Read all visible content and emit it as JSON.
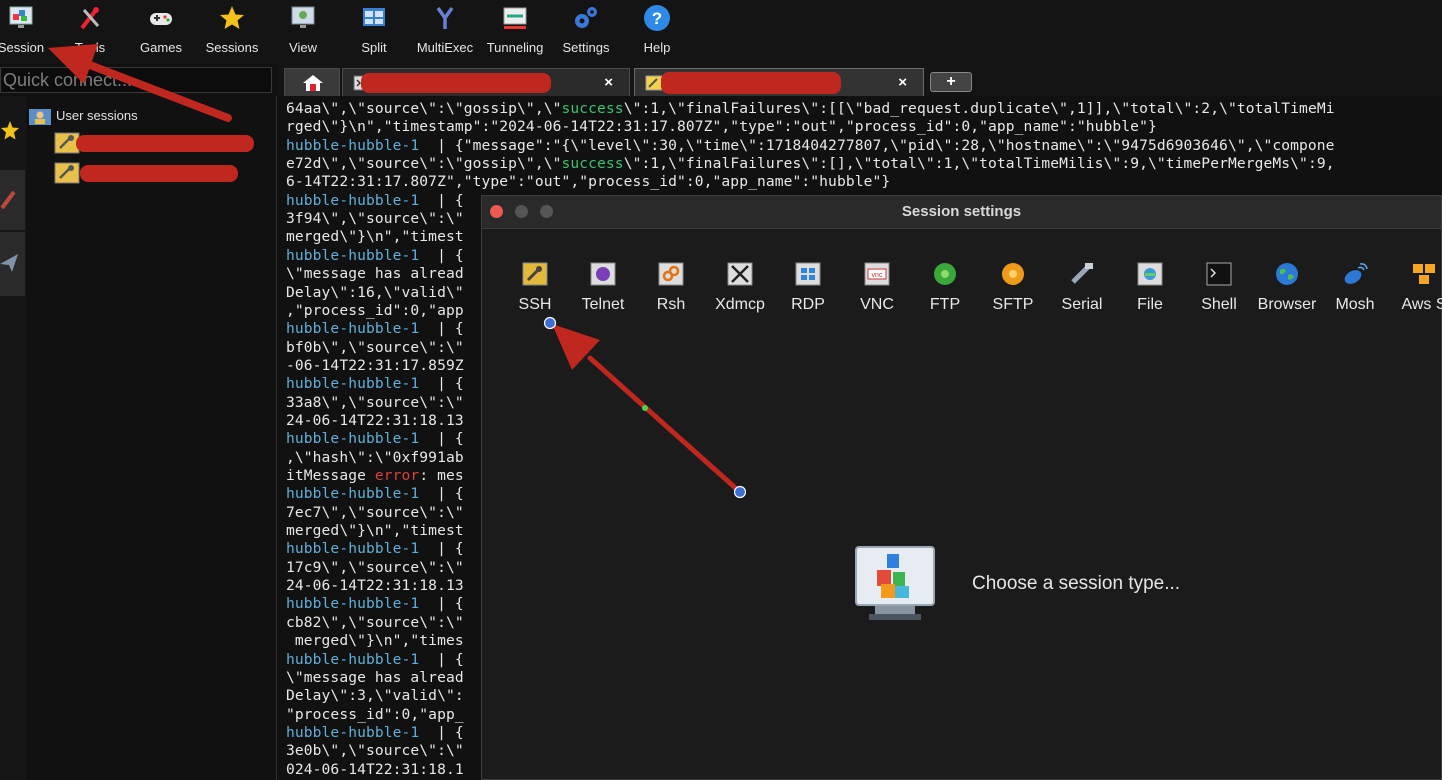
{
  "toolbar": {
    "items": [
      {
        "label": "Session",
        "icon": "session-icon"
      },
      {
        "label": "Tools",
        "icon": "tools-icon"
      },
      {
        "label": "Games",
        "icon": "gamepad-icon"
      },
      {
        "label": "Sessions",
        "icon": "star-icon"
      },
      {
        "label": "View",
        "icon": "view-icon"
      },
      {
        "label": "Split",
        "icon": "split-icon"
      },
      {
        "label": "MultiExec",
        "icon": "multiexec-icon"
      },
      {
        "label": "Tunneling",
        "icon": "tunneling-icon"
      },
      {
        "label": "Settings",
        "icon": "gears-icon"
      },
      {
        "label": "Help",
        "icon": "help-icon"
      }
    ]
  },
  "quick_connect": {
    "placeholder": "Quick connect..."
  },
  "sidebar": {
    "user_sessions_label": "User sessions"
  },
  "tabs": {
    "close_glyph": "×",
    "add_glyph": "+"
  },
  "terminal": {
    "lines": [
      [
        {
          "t": "64aa\\\",\\\"source\\\":\\\"gossip\\\",\\\""
        },
        {
          "t": "success",
          "c": "ok"
        },
        {
          "t": "\\\":1,\\\"finalFailures\\\":[[\\\"bad_request.duplicate\\\",1]],\\\"total\\\":2,\\\"totalTimeMi"
        }
      ],
      [
        {
          "t": "rged\\\"}\\n\",\"timestamp\":\"2024-06-14T22:31:17.807Z\",\"type\":\"out\",\"process_id\":0,\"app_name\":\"hubble\"}"
        }
      ],
      [
        {
          "t": "hubble-hubble-1",
          "c": "host"
        },
        {
          "t": "  | {\"message\":\"{\\\"level\\\":30,\\\"time\\\":1718404277807,\\\"pid\\\":28,\\\"hostname\\\":\\\"9475d6903646\\\",\\\"compone"
        }
      ],
      [
        {
          "t": "e72d\\\",\\\"source\\\":\\\"gossip\\\",\\\""
        },
        {
          "t": "success",
          "c": "ok"
        },
        {
          "t": "\\\":1,\\\"finalFailures\\\":[],\\\"total\\\":1,\\\"totalTimeMilis\\\":9,\\\"timePerMergeMs\\\":9,"
        }
      ],
      [
        {
          "t": "6-14T22:31:17.807Z\",\"type\":\"out\",\"process_id\":0,\"app_name\":\"hubble\"}"
        }
      ],
      [
        {
          "t": "hubble-hubble-1",
          "c": "host"
        },
        {
          "t": "  | {"
        }
      ],
      [
        {
          "t": "3f94\\\",\\\"source\\\":\\\""
        }
      ],
      [
        {
          "t": "merged\\\"}\\n\",\"timest"
        }
      ],
      [
        {
          "t": "hubble-hubble-1",
          "c": "host"
        },
        {
          "t": "  | {"
        }
      ],
      [
        {
          "t": "\\\"message has alread"
        }
      ],
      [
        {
          "t": "Delay\\\":16,\\\"valid\\\""
        }
      ],
      [
        {
          "t": ",\"process_id\":0,\"app"
        }
      ],
      [
        {
          "t": "hubble-hubble-1",
          "c": "host"
        },
        {
          "t": "  | {"
        }
      ],
      [
        {
          "t": "bf0b\\\",\\\"source\\\":\\\""
        }
      ],
      [
        {
          "t": "-06-14T22:31:17.859Z"
        }
      ],
      [
        {
          "t": "hubble-hubble-1",
          "c": "host"
        },
        {
          "t": "  | {"
        }
      ],
      [
        {
          "t": "33a8\\\",\\\"source\\\":\\\""
        }
      ],
      [
        {
          "t": "24-06-14T22:31:18.13"
        }
      ],
      [
        {
          "t": "hubble-hubble-1",
          "c": "host"
        },
        {
          "t": "  | {"
        }
      ],
      [
        {
          "t": ",\\\"hash\\\":\\\"0xf991ab"
        }
      ],
      [
        {
          "t": "itMessage "
        },
        {
          "t": "error",
          "c": "err"
        },
        {
          "t": ": mes"
        }
      ],
      [
        {
          "t": "hubble-hubble-1",
          "c": "host"
        },
        {
          "t": "  | {"
        }
      ],
      [
        {
          "t": "7ec7\\\",\\\"source\\\":\\\""
        }
      ],
      [
        {
          "t": "merged\\\"}\\n\",\"timest"
        }
      ],
      [
        {
          "t": "hubble-hubble-1",
          "c": "host"
        },
        {
          "t": "  | {"
        }
      ],
      [
        {
          "t": "17c9\\\",\\\"source\\\":\\\""
        }
      ],
      [
        {
          "t": "24-06-14T22:31:18.13"
        }
      ],
      [
        {
          "t": "hubble-hubble-1",
          "c": "host"
        },
        {
          "t": "  | {"
        }
      ],
      [
        {
          "t": "cb82\\\",\\\"source\\\":\\\""
        }
      ],
      [
        {
          "t": " merged\\\"}\\n\",\"times"
        }
      ],
      [
        {
          "t": "hubble-hubble-1",
          "c": "host"
        },
        {
          "t": "  | {"
        }
      ],
      [
        {
          "t": "\\\"message has alread"
        }
      ],
      [
        {
          "t": "Delay\\\":3,\\\"valid\\\":"
        }
      ],
      [
        {
          "t": "\"process_id\":0,\"app_"
        }
      ],
      [
        {
          "t": "hubble-hubble-1",
          "c": "host"
        },
        {
          "t": "  | {"
        }
      ],
      [
        {
          "t": "3e0b\\\",\\\"source\\\":\\\""
        }
      ],
      [
        {
          "t": "024-06-14T22:31:18.1"
        }
      ]
    ]
  },
  "dialog": {
    "title": "Session settings",
    "session_types": [
      {
        "label": "SSH",
        "icon": "ssh-icon"
      },
      {
        "label": "Telnet",
        "icon": "telnet-icon"
      },
      {
        "label": "Rsh",
        "icon": "rsh-icon"
      },
      {
        "label": "Xdmcp",
        "icon": "xdmcp-icon"
      },
      {
        "label": "RDP",
        "icon": "rdp-icon"
      },
      {
        "label": "VNC",
        "icon": "vnc-icon"
      },
      {
        "label": "FTP",
        "icon": "ftp-icon"
      },
      {
        "label": "SFTP",
        "icon": "sftp-icon"
      },
      {
        "label": "Serial",
        "icon": "serial-icon"
      },
      {
        "label": "File",
        "icon": "file-icon"
      },
      {
        "label": "Shell",
        "icon": "shell-icon"
      },
      {
        "label": "Browser",
        "icon": "browser-icon"
      },
      {
        "label": "Mosh",
        "icon": "mosh-icon"
      },
      {
        "label": "Aws S",
        "icon": "aws-icon"
      }
    ],
    "prompt": "Choose a session type..."
  },
  "colors": {
    "annotation_red": "#c0271f",
    "host": "#5fb0d8",
    "success": "#39c36f",
    "error": "#d9413a"
  }
}
